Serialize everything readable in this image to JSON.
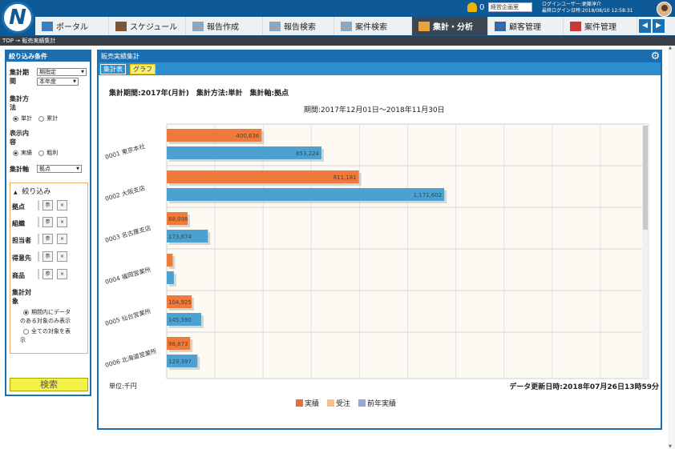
{
  "header": {
    "logo_letter": "N",
    "notification_count": "0",
    "user_select": "経営企画室",
    "user_line1": "ログインユーザー:更藤淳介",
    "user_line2": "最終ログイン日時:2018/08/10 12:58:31"
  },
  "nav": {
    "items": [
      {
        "label": "ポータル"
      },
      {
        "label": "スケジュール"
      },
      {
        "label": "報告作成"
      },
      {
        "label": "報告検索"
      },
      {
        "label": "案件検索"
      },
      {
        "label": "集計・分析"
      },
      {
        "label": "顧客管理"
      },
      {
        "label": "案件管理"
      }
    ],
    "active_index": 5
  },
  "breadcrumb": "TOP → 販売実績集計",
  "sidebar": {
    "title": "絞り込み条件",
    "period_label_1": "集計期",
    "period_label_2": "間",
    "period_select": "期指定",
    "year_select": "本年度",
    "method_label_1": "集計方",
    "method_label_2": "法",
    "method_single": "単計",
    "method_cumulative": "累計",
    "content_label_1": "表示内",
    "content_label_2": "容",
    "content_actual": "実績",
    "content_margin": "粗利",
    "axis_label": "集計軸",
    "axis_select": "拠点",
    "filter_title": "絞り込み",
    "filters": [
      "拠点",
      "組織",
      "担当者",
      "得意先",
      "商品"
    ],
    "ref_label": "参",
    "clear_label": "×",
    "target_label_1": "集計対",
    "target_label_2": "象",
    "target_opt1_1": "期間内にデータ",
    "target_opt1_2": "のある対象のみ表示",
    "target_opt2_1": "全ての対象を表",
    "target_opt2_2": "示",
    "search_button": "検索"
  },
  "main": {
    "title": "販売実績集計",
    "tab_table": "集計表",
    "tab_graph": "グラフ",
    "heading": "集計期間:2017年(月計)　集計方法:単計　集計軸:拠点",
    "period": "期間:2017年12月01日～2018年11月30日",
    "unit": "単位:千円",
    "updated": "データ更新日時:2018年07月26日13時59分"
  },
  "chart_data": {
    "type": "bar",
    "orientation": "horizontal",
    "categories": [
      "0001 東京本社",
      "0002 大阪支店",
      "0003 名古屋支店",
      "0004 福岡営業所",
      "0005 仙台営業所",
      "0006 北海道営業所"
    ],
    "series": [
      {
        "name": "実績",
        "color": "#ee7a3c",
        "values": [
          400636,
          811181,
          88098,
          25000,
          104925,
          98873
        ],
        "labels": [
          "400,636",
          "811,181",
          "88,098",
          "",
          "104,925",
          "98,873"
        ]
      },
      {
        "name": "前年実績",
        "color": "#4ba2d0",
        "values": [
          653224,
          1171602,
          173874,
          30000,
          145590,
          129397
        ],
        "labels": [
          "653,224",
          "1,171,602",
          "173,874",
          "",
          "145,590",
          "129,397"
        ]
      }
    ],
    "legend": [
      {
        "name": "実績",
        "color": "#ee6a3a"
      },
      {
        "name": "受注",
        "color": "#f6c08a"
      },
      {
        "name": "前年実績",
        "color": "#9aa6d8"
      }
    ],
    "xlim": [
      0,
      2000000
    ],
    "grid": true
  }
}
